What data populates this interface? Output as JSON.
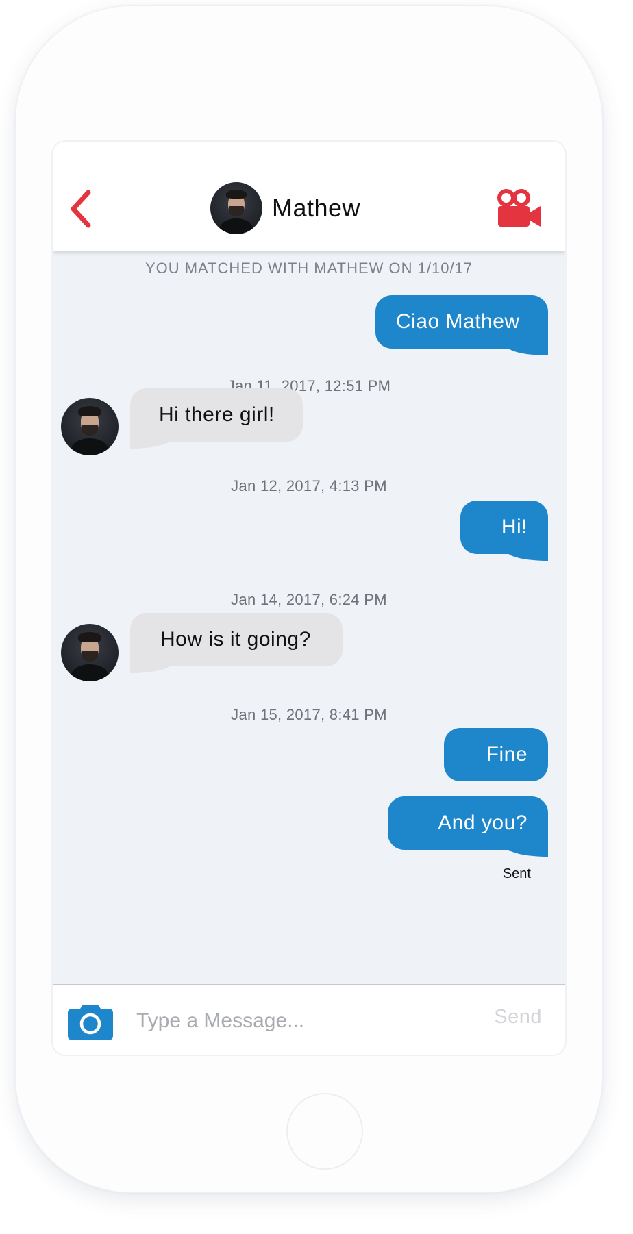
{
  "header": {
    "contact_name": "Mathew",
    "back_icon": "chevron-left-icon",
    "video_icon": "video-camera-icon",
    "accent_color": "#e3343f"
  },
  "conversation": {
    "match_note": "YOU MATCHED WITH MATHEW ON 1/10/17",
    "timestamps": [
      "Jan 11, 2017, 12:51 PM",
      "Jan 12, 2017, 4:13 PM",
      "Jan 14, 2017, 6:24 PM",
      "Jan 15, 2017, 8:41 PM"
    ],
    "messages": [
      {
        "direction": "outgoing",
        "text": "Ciao Mathew"
      },
      {
        "direction": "incoming",
        "text": "Hi there girl!"
      },
      {
        "direction": "outgoing",
        "text": "Hi!"
      },
      {
        "direction": "incoming",
        "text": "How is it going?"
      },
      {
        "direction": "outgoing",
        "text": "Fine"
      },
      {
        "direction": "outgoing",
        "text": "And you?"
      }
    ],
    "status": "Sent",
    "outgoing_color": "#1e87cc",
    "incoming_color": "#e4e4e6"
  },
  "composer": {
    "camera_icon": "camera-icon",
    "placeholder": "Type a Message...",
    "value": "",
    "send_label": "Send"
  }
}
